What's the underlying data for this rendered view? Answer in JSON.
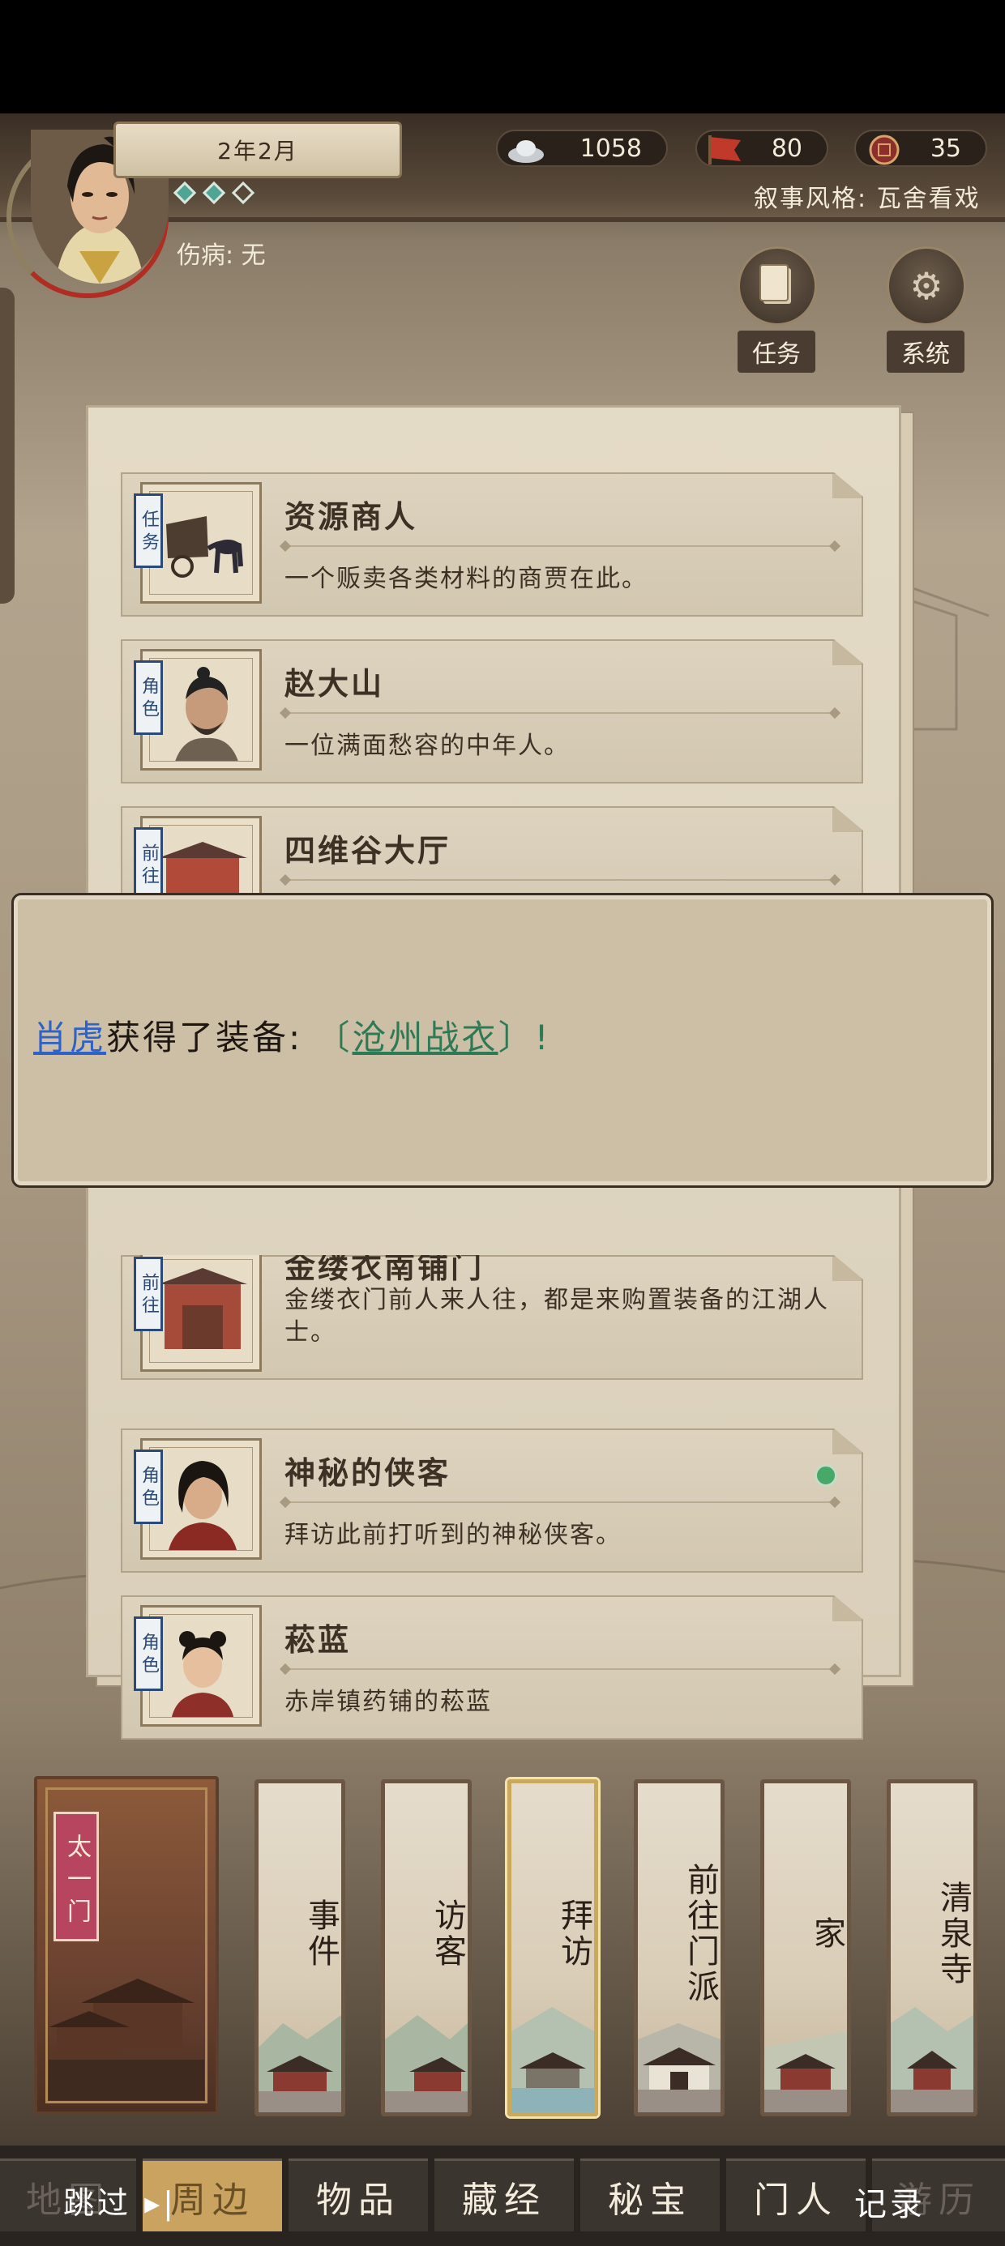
{
  "header": {
    "date": "2年2月",
    "injury_label": "伤病: 无",
    "narrative_style": "叙事风格: 瓦舍看戏",
    "resources": [
      {
        "icon": "silver-ingot-icon",
        "value": "1058"
      },
      {
        "icon": "banner-icon",
        "value": "80"
      },
      {
        "icon": "seal-coin-icon",
        "value": "35"
      }
    ],
    "buttons": {
      "task": "任务",
      "system": "系统"
    }
  },
  "cards": [
    {
      "tag": "任务",
      "title": "资源商人",
      "desc": "一个贩卖各类材料的商贾在此。"
    },
    {
      "tag": "角色",
      "title": "赵大山",
      "desc": "一位满面愁容的中年人。"
    },
    {
      "tag": "前往",
      "title": "四维谷大厅",
      "desc": ""
    },
    {
      "tag": "前往",
      "title": "金缕衣南铺门",
      "desc": "金缕衣门前人来人往，都是来购置装备的江湖人士。"
    },
    {
      "tag": "角色",
      "title": "神秘的侠客",
      "desc": "拜访此前打听到的神秘侠客。"
    },
    {
      "tag": "角色",
      "title": "菘蓝",
      "desc": "赤岸镇药铺的菘蓝"
    }
  ],
  "dialog": {
    "who": "肖虎",
    "middle": "获得了装备:",
    "bracket_open": "〔",
    "item": "沧州战衣",
    "bracket_close": "〕!"
  },
  "destinations": {
    "home_seal": "太一门",
    "strips": [
      "事件",
      "访客",
      "拜访",
      "前往门派",
      "家",
      "清泉寺"
    ],
    "active": "拜访"
  },
  "tabs": [
    "地图",
    "周边",
    "物品",
    "藏经",
    "秘宝",
    "门人",
    "游历"
  ],
  "bottom_overlay": {
    "skip": "跳过",
    "record": "记录"
  },
  "colors": {
    "accent_gold": "#c9a35f",
    "link_blue": "#2f62c9",
    "item_green": "#2f7a56",
    "status_green": "#48a86a"
  }
}
